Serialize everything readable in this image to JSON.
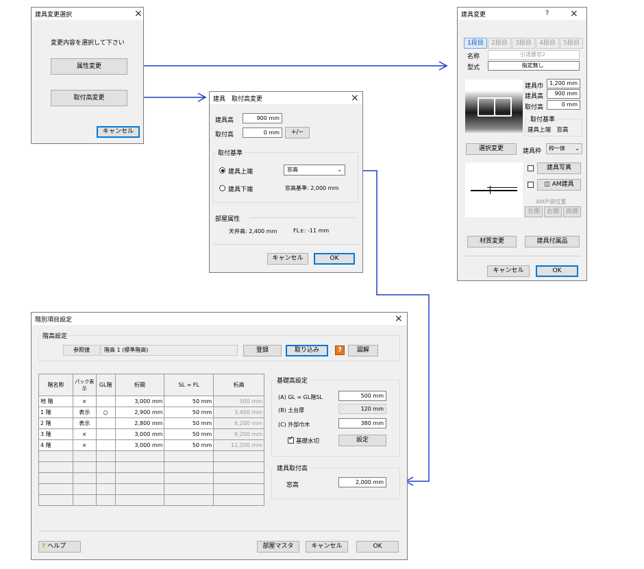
{
  "dlg_select": {
    "title": "建具変更選択",
    "prompt": "変更内容を選択して下さい",
    "btn_attr": "属性変更",
    "btn_height": "取付高変更",
    "btn_cancel": "キャンセル"
  },
  "dlg_height": {
    "title": "建具　取付高変更",
    "lbl_h": "建具高",
    "val_h": "900 mm",
    "lbl_mount": "取付高",
    "val_mount": "0 mm",
    "btn_pm": "+/−",
    "grp_base": "取付基準",
    "rad_top": "建具上端",
    "rad_bottom": "建具下端",
    "combo": "窓高",
    "base_info": "窓高基準: 2,000 mm",
    "grp_room": "部屋属性",
    "ceiling": "天井高: 2,400 mm",
    "fl": "FL±: -11 mm",
    "btn_cancel": "キャンセル",
    "btn_ok": "OK"
  },
  "dlg_prop": {
    "title": "建具変更",
    "help": "?",
    "tabs": [
      "1段目",
      "2段目",
      "3段目",
      "4段目",
      "5段目"
    ],
    "lbl_name": "名称",
    "val_name": "引違腰窓2",
    "lbl_type": "型式",
    "val_type": "指定無し",
    "lbl_w": "建具巾",
    "val_w": "1,200 mm",
    "lbl_h": "建具高",
    "val_h": "900 mm",
    "lbl_m": "取付高",
    "val_m": "0 mm",
    "grp_base": "取付基準",
    "base_val": "建具上端　窓高",
    "btn_sel": "選択変更",
    "lbl_frame": "建具枠",
    "frame_val": "枠一体",
    "chk_photo": "建具写真",
    "chk_am": "AM建具",
    "am_pos": "AM戸袋位置",
    "btn_left": "左側",
    "btn_right": "右側",
    "btn_both": "両側",
    "btn_mat": "材質変更",
    "btn_acc": "建具付属品",
    "btn_cancel": "キャンセル",
    "btn_ok": "OK"
  },
  "dlg_floor": {
    "title": "階別項目設定",
    "grp_floor": "階高設定",
    "lbl_ref": "参照値",
    "ref_val": "階高 1 (標準階高)",
    "btn_reg": "登録",
    "btn_import": "取り込み",
    "help_q": "?",
    "btn_fig": "図解",
    "headers": [
      "階名称",
      "パック表示",
      "GL階",
      "桁間",
      "SL ∞ FL",
      "桁高"
    ],
    "rows": [
      [
        "地 階",
        "×",
        "",
        "3,000 mm",
        "50 mm",
        "500 mm"
      ],
      [
        "1 階",
        "表示",
        "○",
        "2,900 mm",
        "50 mm",
        "3,400 mm"
      ],
      [
        "2 階",
        "表示",
        "",
        "2,800 mm",
        "50 mm",
        "6,200 mm"
      ],
      [
        "3 階",
        "×",
        "",
        "3,000 mm",
        "50 mm",
        "9,200 mm"
      ],
      [
        "4 階",
        "×",
        "",
        "3,000 mm",
        "50 mm",
        "12,200 mm"
      ]
    ],
    "grp_base": "基礎高設定",
    "lbl_a": "(A) GL ∞ GL階SL",
    "val_a": "500 mm",
    "lbl_b": "(B) 土台厚",
    "val_b": "120 mm",
    "lbl_c": "(C) 外部巾木",
    "val_c": "380 mm",
    "chk_water": "基礎水切",
    "btn_set": "設定",
    "grp_mount": "建具取付高",
    "lbl_win": "窓高",
    "val_win": "2,000 mm",
    "btn_help": "ヘルプ",
    "btn_room": "部屋マスタ",
    "btn_cancel": "キャンセル",
    "btn_ok": "OK"
  },
  "colors": {
    "arrow": "#1a3cc8",
    "tab_selected": "#0a60c0"
  }
}
